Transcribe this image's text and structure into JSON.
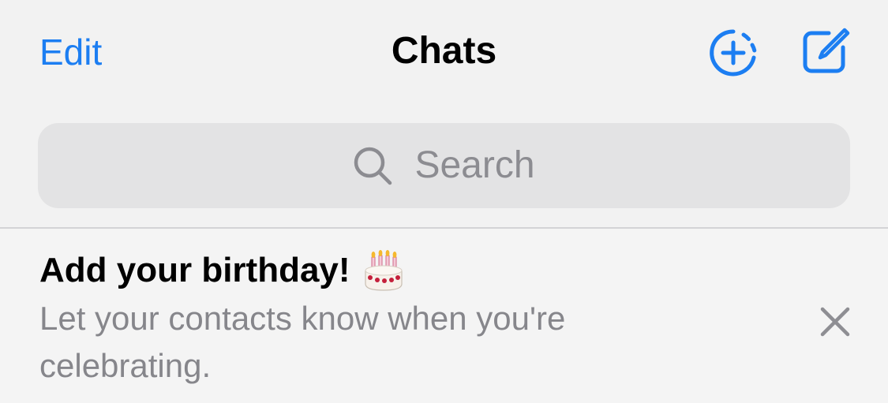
{
  "nav": {
    "edit_label": "Edit",
    "title": "Chats",
    "status_icon": "add-status-icon",
    "compose_icon": "compose-icon"
  },
  "search": {
    "placeholder": "Search",
    "icon": "search-icon"
  },
  "banner": {
    "title": "Add your birthday!",
    "title_icon": "birthday-cake-icon",
    "body": "Let your contacts know when you're celebrating.",
    "dismiss_icon": "close-icon"
  },
  "colors": {
    "accent": "#1c7ef2",
    "background": "#f2f2f2",
    "search_background": "#e3e3e4",
    "secondary_text": "#86868b"
  }
}
